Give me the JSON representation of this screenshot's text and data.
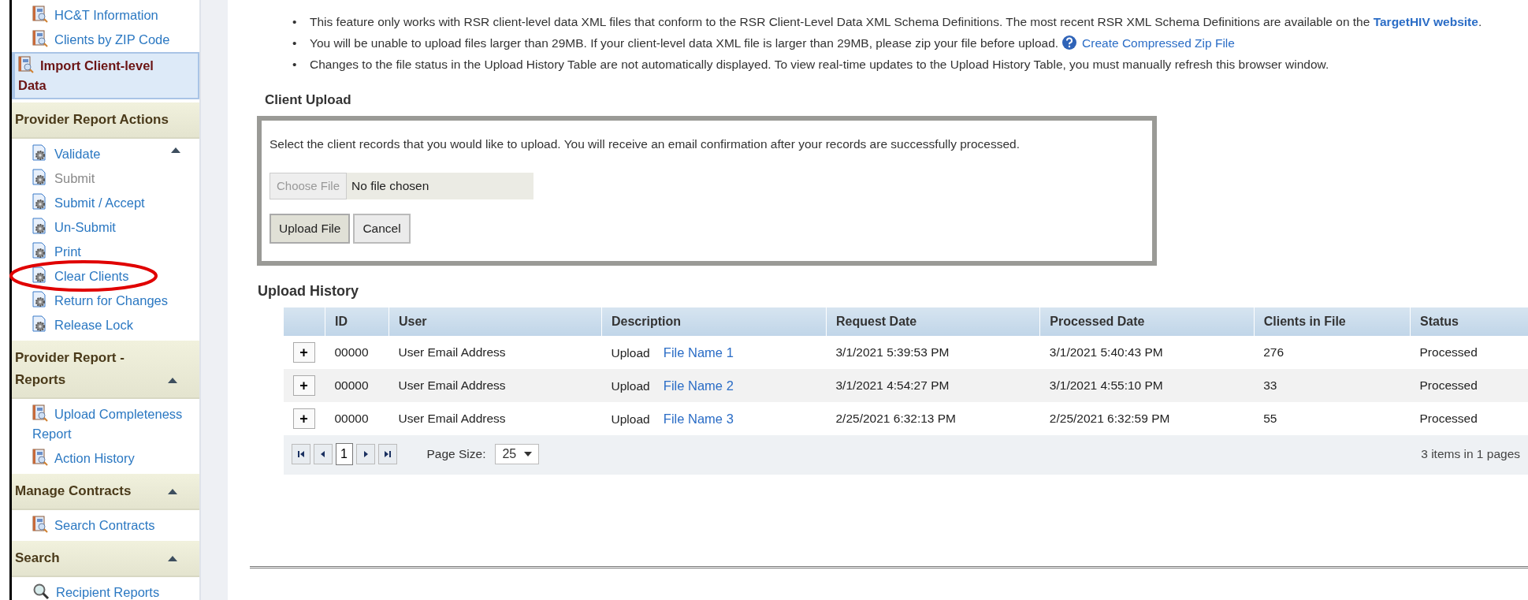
{
  "sidebar": {
    "sections": [
      {
        "kind": "plain",
        "items": [
          {
            "label": "HC&T Information",
            "kind": "report",
            "selected": false,
            "disabled": false,
            "circled": false
          },
          {
            "label": "Clients by ZIP Code",
            "kind": "report",
            "selected": false,
            "disabled": false,
            "circled": false
          },
          {
            "label": "Import Client-level Data",
            "kind": "report",
            "selected": true,
            "disabled": false,
            "circled": false
          }
        ]
      },
      {
        "title": "Provider Report Actions",
        "kind": "actions",
        "items": [
          {
            "label": "Validate",
            "kind": "action",
            "selected": false,
            "disabled": false,
            "circled": false
          },
          {
            "label": "Submit",
            "kind": "action",
            "selected": false,
            "disabled": true,
            "circled": false
          },
          {
            "label": "Submit / Accept",
            "kind": "action",
            "selected": false,
            "disabled": false,
            "circled": false
          },
          {
            "label": "Un-Submit",
            "kind": "action",
            "selected": false,
            "disabled": false,
            "circled": false
          },
          {
            "label": "Print",
            "kind": "action",
            "selected": false,
            "disabled": false,
            "circled": false
          },
          {
            "label": "Clear Clients",
            "kind": "action",
            "selected": false,
            "disabled": false,
            "circled": true
          },
          {
            "label": "Return for Changes",
            "kind": "action",
            "selected": false,
            "disabled": false,
            "circled": false
          },
          {
            "label": "Release Lock",
            "kind": "action",
            "selected": false,
            "disabled": false,
            "circled": false
          }
        ]
      },
      {
        "title": "Provider Report - Reports",
        "kind": "group",
        "items": [
          {
            "label": "Upload Completeness Report",
            "kind": "report",
            "selected": false,
            "disabled": false,
            "circled": false
          },
          {
            "label": "Action History",
            "kind": "report",
            "selected": false,
            "disabled": false,
            "circled": false
          }
        ]
      },
      {
        "title": "Manage Contracts",
        "kind": "group",
        "items": [
          {
            "label": "Search Contracts",
            "kind": "report",
            "selected": false,
            "disabled": false,
            "circled": false
          }
        ]
      },
      {
        "title": "Search",
        "kind": "group",
        "items": [
          {
            "label": "Recipient Reports",
            "kind": "search",
            "selected": false,
            "disabled": false,
            "circled": false
          }
        ]
      }
    ]
  },
  "notes": [
    {
      "bullet": "•",
      "text": "This feature only works with RSR client-level data XML files that conform to the RSR Client-Level Data XML Schema Definitions. The most recent RSR XML Schema Definitions are available on the",
      "link": "TargetHIV website",
      "link_bold": true,
      "after": "."
    },
    {
      "bullet": "•",
      "text": "You will be unable to upload files larger than 29MB. If your client-level data XML file is larger than 29MB, please zip your file before upload.",
      "help_icon": true,
      "link": "Create Compressed Zip File",
      "link_bold": false
    },
    {
      "bullet": "•",
      "text": "Changes to the file status in the Upload History Table are not automatically displayed. To view real-time updates to the Upload History Table, you must manually refresh this browser window."
    }
  ],
  "client_upload": {
    "title": "Client Upload",
    "instructions": "Select the client records that you would like to upload. You will receive an email confirmation after your records are successfully processed.",
    "choose_button": "Choose File",
    "file_status": "No file chosen",
    "choose_disabled": true,
    "buttons": [
      "Upload File",
      "Cancel"
    ]
  },
  "upload_history": {
    "title": "Upload History",
    "columns": [
      "",
      "ID",
      "User",
      "Description",
      "Request Date",
      "Processed Date",
      "Clients in File",
      "Status"
    ],
    "rows": [
      {
        "expand": "+",
        "id": "00000",
        "user": "User Email Address",
        "description": "Upload",
        "file": "File Name 1",
        "request_date": "3/1/2021 5:39:53 PM",
        "processed_date": "3/1/2021 5:40:43 PM",
        "clients": "276",
        "status": "Processed"
      },
      {
        "expand": "+",
        "id": "00000",
        "user": "User Email Address",
        "description": "Upload",
        "file": "File Name 2",
        "request_date": "3/1/2021 4:54:27 PM",
        "processed_date": "3/1/2021 4:55:10 PM",
        "clients": "33",
        "status": "Processed"
      },
      {
        "expand": "+",
        "id": "00000",
        "user": "User Email Address",
        "description": "Upload",
        "file": "File Name 3",
        "request_date": "2/25/2021 6:32:13 PM",
        "processed_date": "2/25/2021 6:32:59 PM",
        "clients": "55",
        "status": "Processed"
      }
    ],
    "pager": {
      "pages": [
        {
          "label": "1",
          "selected": true
        }
      ],
      "page_size_label": "Page Size:",
      "page_size": "25",
      "summary": "3 items in 1 pages"
    }
  }
}
